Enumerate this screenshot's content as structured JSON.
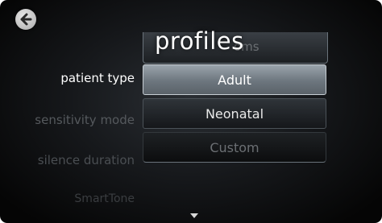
{
  "header": {
    "back_icon": "arrow-left-circle-icon"
  },
  "settings": {
    "patient_type": "patient type",
    "sensitivity_mode": "sensitivity mode",
    "silence_duration": "silence duration",
    "smart_tone": "SmartTone"
  },
  "popup": {
    "title": "profiles",
    "header_ghost": "oms",
    "options": [
      "Adult",
      "Neonatal",
      "Custom"
    ],
    "selected": "Adult"
  },
  "scroll_indicator_icon": "triangle-down-icon"
}
